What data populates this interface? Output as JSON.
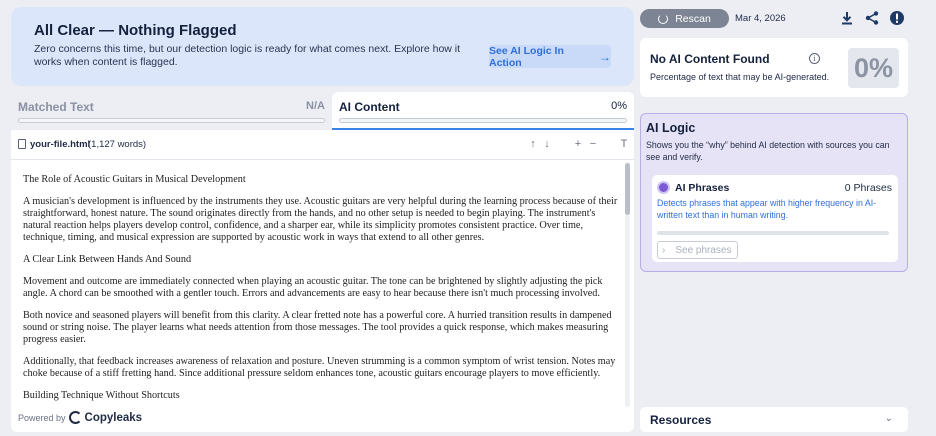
{
  "banner": {
    "title": "All Clear — Nothing Flagged",
    "text": "Zero concerns this time, but our detection logic is ready for what comes next. Explore how it works when content is flagged.",
    "button_label": "See AI Logic In Action",
    "button_icon": "arrow-right-icon"
  },
  "tabs": [
    {
      "label": "Matched Text",
      "value": "N/A"
    },
    {
      "label": "AI Content",
      "value": "0%"
    }
  ],
  "document": {
    "file_name": "your-file.html",
    "word_count": "(1,127 words)",
    "paragraphs": [
      "The Role of Acoustic Guitars in Musical Development",
      "A musician's development is influenced by the instruments they use. Acoustic guitars are very helpful during the learning process because of their straightforward, honest nature. The sound originates directly from the hands, and no other setup is needed to begin playing. The instrument's natural reaction helps players develop control, confidence, and a sharper ear, while its simplicity promotes consistent practice. Over time, technique, timing, and musical expression are supported by acoustic work in ways that extend to all other genres.",
      "A Clear Link Between Hands And Sound",
      "Movement and outcome are immediately connected when playing an acoustic guitar. The tone can be brightened by slightly adjusting the pick angle. A chord can be smoothed with a gentler touch. Errors and advancements are easy to hear because there isn't much processing involved.",
      "Both novice and seasoned players will benefit from this clarity. A clear fretted note has a powerful core. A hurried transition results in dampened sound or string noise. The player learns what needs attention from those messages. The tool provides a quick response, which makes measuring progress easier.",
      "Additionally, that feedback increases awareness of relaxation and posture. Uneven strumming is a common symptom of wrist tension. Notes may choke because of a stiff fretting hand. Since additional pressure seldom enhances tone, acoustic guitars encourage players to move efficiently.",
      "Building Technique Without Shortcuts"
    ],
    "powered_by": "Powered by",
    "brand": "Copyleaks"
  },
  "toolbar": {
    "rescan_label": "Rescan",
    "date": "Mar 4, 2026"
  },
  "result": {
    "title": "No AI Content Found",
    "subtitle": "Percentage of text that may be AI-generated.",
    "percent": "0%"
  },
  "ai_logic": {
    "title": "AI Logic",
    "subtitle": "Shows you the “why” behind AI detection with sources you can see and verify.",
    "phrases": {
      "title": "AI Phrases",
      "count": "0 Phrases",
      "description": "Detects phrases that appear with higher frequency in AI-written text than in human writing.",
      "button_label": "See phrases"
    }
  },
  "resources": {
    "title": "Resources"
  },
  "colors": {
    "accent": "#3b82e6",
    "logic_bg": "#e7e3f7",
    "banner_bg": "#dbe6fb"
  }
}
